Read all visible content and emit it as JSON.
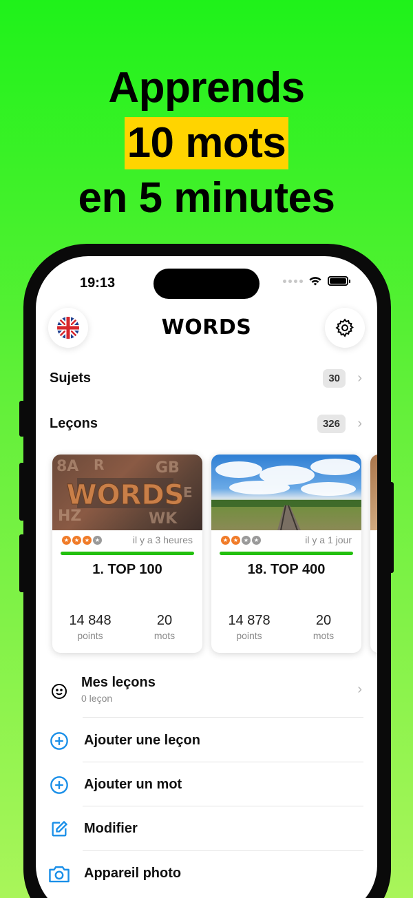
{
  "headline": {
    "line1": "Apprends",
    "line2": "10 mots",
    "line3": "en 5 minutes"
  },
  "status_bar": {
    "time": "19:13"
  },
  "header": {
    "title": "WORDS",
    "language_icon": "uk-flag-icon",
    "settings_icon": "gear-icon"
  },
  "rows": {
    "topics": {
      "label": "Sujets",
      "count": "30"
    },
    "lessons": {
      "label": "Leçons",
      "count": "326"
    }
  },
  "cards": [
    {
      "title": "1. TOP 100",
      "ago": "il y a 3 heures",
      "stars": 3,
      "points": "14 848",
      "points_label": "points",
      "words": "20",
      "words_label": "mots",
      "progress": 1.0,
      "image": "wooden-letters-words"
    },
    {
      "title": "18. TOP 400",
      "ago": "il y a 1 jour",
      "stars": 2,
      "points": "14 878",
      "points_label": "points",
      "words": "20",
      "words_label": "mots",
      "progress": 1.0,
      "image": "railway-landscape"
    }
  ],
  "my_lessons": {
    "label": "Mes leçons",
    "sub": "0 leçon",
    "icon": "smiley-icon"
  },
  "actions": [
    {
      "label": "Ajouter une leçon",
      "icon": "plus-circle-icon"
    },
    {
      "label": "Ajouter un mot",
      "icon": "plus-circle-icon"
    },
    {
      "label": "Modifier",
      "icon": "edit-icon"
    },
    {
      "label": "Appareil photo",
      "icon": "camera-icon"
    }
  ],
  "colors": {
    "accent": "#1a8fe8",
    "progress": "#23c00e",
    "star": "#f07c2a",
    "highlight": "#ffd400"
  }
}
